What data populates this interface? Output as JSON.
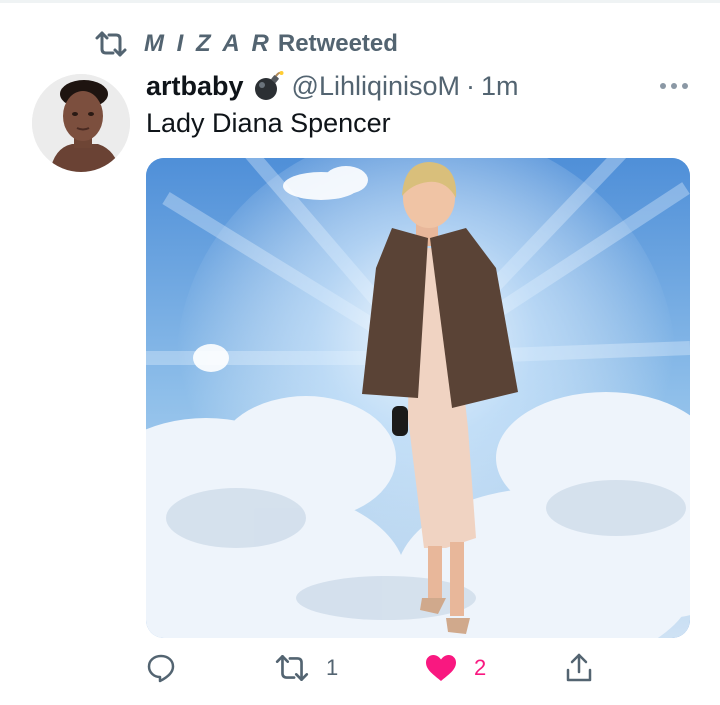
{
  "retweet_banner": {
    "icon": "retweet-icon",
    "user": "M I Z A R",
    "suffix": "Retweeted"
  },
  "tweet": {
    "author": {
      "display_name": "artbaby",
      "badge_emoji": "bomb-icon",
      "handle": "@LihliqinisoM",
      "separator": "·",
      "time": "1m"
    },
    "text": "Lady Diana Spencer",
    "media": {
      "description_icon": "photo"
    }
  },
  "actions": {
    "reply": {
      "icon": "reply-icon",
      "count": ""
    },
    "retweet": {
      "icon": "retweet-icon",
      "count": "1"
    },
    "like": {
      "icon": "heart-filled-icon",
      "count": "2",
      "liked": true,
      "color": "#f91880"
    },
    "share": {
      "icon": "share-icon",
      "count": ""
    }
  },
  "colors": {
    "secondary_text": "#536471",
    "primary_text": "#0f1419",
    "like_active": "#f91880"
  }
}
